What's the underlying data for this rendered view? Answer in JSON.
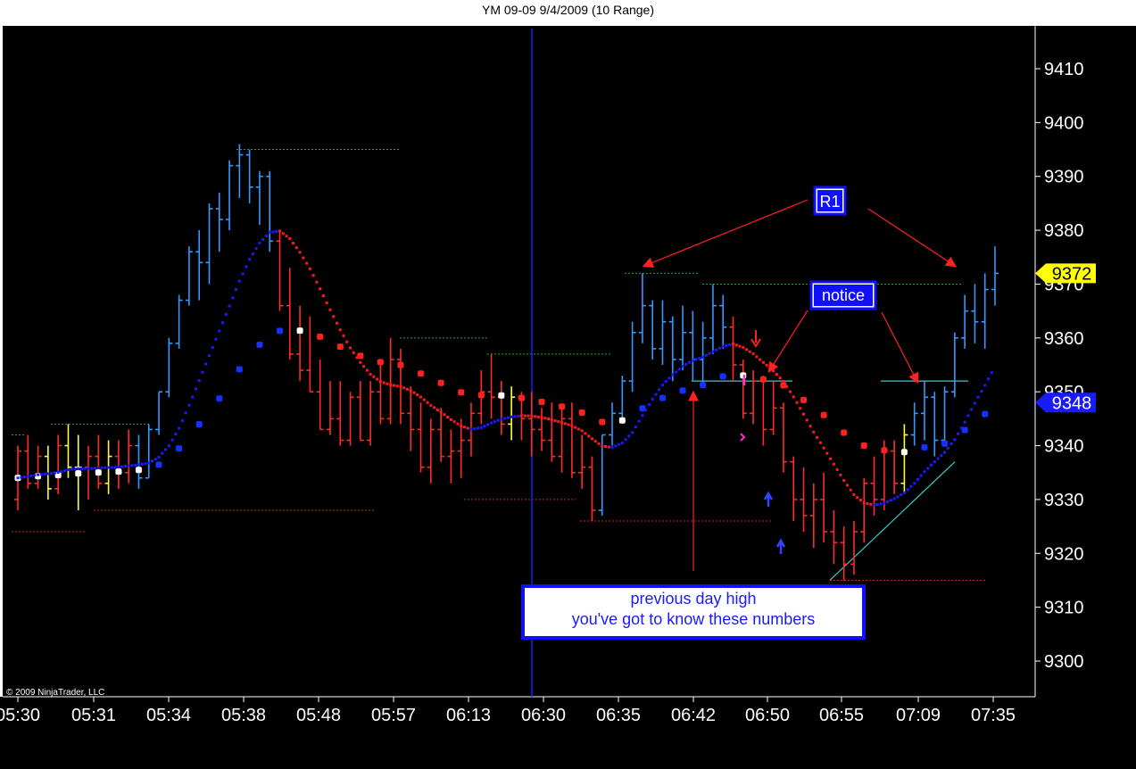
{
  "window": {
    "title": "YM 09-09  9/4/2009 (10 Range)"
  },
  "copyright": "© 2009 NinjaTrader, LLC",
  "annotations": {
    "r1": "R1",
    "notice": "notice",
    "note_line1": "previous day high",
    "note_line2": "you've got to know these numbers"
  },
  "colors": {
    "background": "#000000",
    "up_bar": "#3399ff",
    "down_bar": "#ff2a2a",
    "neutral_bar": "#ffff33",
    "slow_avg_up": "#1530ff",
    "slow_avg_down": "#ff2020",
    "slow_avg_flat": "#ffffff",
    "fast_avg_up": "#1a1aff",
    "fast_avg_down": "#ff1a1a",
    "arrows": "#ff2020",
    "level_lines": "#33cccc",
    "note_border": "#1010ff"
  },
  "chart_data": {
    "type": "ohlc",
    "symbol": "YM 09-09",
    "date": "9/4/2009",
    "bar_type": "10 Range",
    "ylim": [
      9294,
      9414
    ],
    "y_ticks": [
      9300,
      9310,
      9320,
      9330,
      9340,
      9350,
      9360,
      9370,
      9380,
      9390,
      9400,
      9410
    ],
    "x_tick_labels": [
      "05:30",
      "05:31",
      "05:34",
      "05:38",
      "05:48",
      "05:57",
      "06:13",
      "06:30",
      "06:35",
      "06:42",
      "06:50",
      "06:55",
      "07:09",
      "07:35"
    ],
    "price_markers": [
      {
        "label": "9372",
        "value": 9372,
        "color": "#ffff00"
      },
      {
        "label": "9348",
        "value": 9348,
        "color": "#1a1aff"
      }
    ],
    "bars": [
      {
        "o": 9330,
        "h": 9340,
        "l": 9328,
        "c": 9339,
        "color": "red"
      },
      {
        "o": 9339,
        "h": 9342,
        "l": 9332,
        "c": 9333,
        "color": "red"
      },
      {
        "o": 9333,
        "h": 9340,
        "l": 9332,
        "c": 9338,
        "color": "red"
      },
      {
        "o": 9338,
        "h": 9340,
        "l": 9330,
        "c": 9332,
        "color": "yellow"
      },
      {
        "o": 9332,
        "h": 9342,
        "l": 9331,
        "c": 9340,
        "color": "red"
      },
      {
        "o": 9340,
        "h": 9344,
        "l": 9334,
        "c": 9336,
        "color": "yellow"
      },
      {
        "o": 9336,
        "h": 9342,
        "l": 9328,
        "c": 9336,
        "color": "yellow"
      },
      {
        "o": 9336,
        "h": 9340,
        "l": 9330,
        "c": 9338,
        "color": "red"
      },
      {
        "o": 9338,
        "h": 9342,
        "l": 9332,
        "c": 9333,
        "color": "red"
      },
      {
        "o": 9333,
        "h": 9341,
        "l": 9331,
        "c": 9338,
        "color": "yellow"
      },
      {
        "o": 9338,
        "h": 9341,
        "l": 9332,
        "c": 9335,
        "color": "red"
      },
      {
        "o": 9335,
        "h": 9343,
        "l": 9333,
        "c": 9340,
        "color": "red"
      },
      {
        "o": 9340,
        "h": 9342,
        "l": 9332,
        "c": 9334,
        "color": "blue"
      },
      {
        "o": 9334,
        "h": 9344,
        "l": 9334,
        "c": 9343,
        "color": "blue"
      },
      {
        "o": 9343,
        "h": 9350,
        "l": 9342,
        "c": 9350,
        "color": "blue"
      },
      {
        "o": 9350,
        "h": 9360,
        "l": 9349,
        "c": 9359,
        "color": "blue"
      },
      {
        "o": 9359,
        "h": 9368,
        "l": 9358,
        "c": 9367,
        "color": "blue"
      },
      {
        "o": 9367,
        "h": 9377,
        "l": 9366,
        "c": 9376,
        "color": "blue"
      },
      {
        "o": 9376,
        "h": 9380,
        "l": 9367,
        "c": 9374,
        "color": "blue"
      },
      {
        "o": 9374,
        "h": 9385,
        "l": 9370,
        "c": 9384,
        "color": "blue"
      },
      {
        "o": 9384,
        "h": 9387,
        "l": 9376,
        "c": 9382,
        "color": "blue"
      },
      {
        "o": 9382,
        "h": 9393,
        "l": 9380,
        "c": 9392,
        "color": "blue"
      },
      {
        "o": 9392,
        "h": 9396,
        "l": 9386,
        "c": 9394,
        "color": "blue"
      },
      {
        "o": 9394,
        "h": 9395,
        "l": 9385,
        "c": 9388,
        "color": "blue"
      },
      {
        "o": 9388,
        "h": 9391,
        "l": 9381,
        "c": 9390,
        "color": "blue"
      },
      {
        "o": 9390,
        "h": 9391,
        "l": 9376,
        "c": 9378,
        "color": "blue"
      },
      {
        "o": 9378,
        "h": 9380,
        "l": 9365,
        "c": 9366,
        "color": "red"
      },
      {
        "o": 9366,
        "h": 9373,
        "l": 9356,
        "c": 9357,
        "color": "red"
      },
      {
        "o": 9357,
        "h": 9366,
        "l": 9352,
        "c": 9354,
        "color": "red"
      },
      {
        "o": 9354,
        "h": 9364,
        "l": 9350,
        "c": 9350,
        "color": "red"
      },
      {
        "o": 9350,
        "h": 9356,
        "l": 9343,
        "c": 9343,
        "color": "red"
      },
      {
        "o": 9343,
        "h": 9352,
        "l": 9342,
        "c": 9345,
        "color": "red"
      },
      {
        "o": 9345,
        "h": 9352,
        "l": 9340,
        "c": 9341,
        "color": "red"
      },
      {
        "o": 9341,
        "h": 9350,
        "l": 9340,
        "c": 9349,
        "color": "red"
      },
      {
        "o": 9349,
        "h": 9352,
        "l": 9341,
        "c": 9341,
        "color": "red"
      },
      {
        "o": 9341,
        "h": 9352,
        "l": 9340,
        "c": 9350,
        "color": "red"
      },
      {
        "o": 9350,
        "h": 9356,
        "l": 9344,
        "c": 9345,
        "color": "red"
      },
      {
        "o": 9345,
        "h": 9360,
        "l": 9344,
        "c": 9356,
        "color": "red"
      },
      {
        "o": 9356,
        "h": 9358,
        "l": 9344,
        "c": 9346,
        "color": "red"
      },
      {
        "o": 9346,
        "h": 9351,
        "l": 9339,
        "c": 9343,
        "color": "red"
      },
      {
        "o": 9343,
        "h": 9348,
        "l": 9335,
        "c": 9336,
        "color": "red"
      },
      {
        "o": 9336,
        "h": 9345,
        "l": 9333,
        "c": 9343,
        "color": "red"
      },
      {
        "o": 9343,
        "h": 9347,
        "l": 9337,
        "c": 9338,
        "color": "red"
      },
      {
        "o": 9338,
        "h": 9343,
        "l": 9333,
        "c": 9339,
        "color": "red"
      },
      {
        "o": 9339,
        "h": 9345,
        "l": 9334,
        "c": 9341,
        "color": "red"
      },
      {
        "o": 9341,
        "h": 9348,
        "l": 9338,
        "c": 9346,
        "color": "red"
      },
      {
        "o": 9346,
        "h": 9354,
        "l": 9344,
        "c": 9350,
        "color": "red"
      },
      {
        "o": 9350,
        "h": 9357,
        "l": 9345,
        "c": 9349,
        "color": "red"
      },
      {
        "o": 9349,
        "h": 9352,
        "l": 9342,
        "c": 9344,
        "color": "red"
      },
      {
        "o": 9344,
        "h": 9351,
        "l": 9341,
        "c": 9349,
        "color": "yellow"
      },
      {
        "o": 9349,
        "h": 9350,
        "l": 9341,
        "c": 9345,
        "color": "red"
      },
      {
        "o": 9345,
        "h": 9350,
        "l": 9338,
        "c": 9343,
        "color": "red"
      },
      {
        "o": 9343,
        "h": 9347,
        "l": 9339,
        "c": 9341,
        "color": "red"
      },
      {
        "o": 9341,
        "h": 9348,
        "l": 9337,
        "c": 9338,
        "color": "red"
      },
      {
        "o": 9338,
        "h": 9347,
        "l": 9335,
        "c": 9345,
        "color": "red"
      },
      {
        "o": 9345,
        "h": 9348,
        "l": 9334,
        "c": 9335,
        "color": "red"
      },
      {
        "o": 9335,
        "h": 9342,
        "l": 9332,
        "c": 9336,
        "color": "red"
      },
      {
        "o": 9336,
        "h": 9338,
        "l": 9326,
        "c": 9328,
        "color": "red"
      },
      {
        "o": 9328,
        "h": 9342,
        "l": 9327,
        "c": 9342,
        "color": "blue"
      },
      {
        "o": 9342,
        "h": 9348,
        "l": 9340,
        "c": 9346,
        "color": "blue"
      },
      {
        "o": 9346,
        "h": 9353,
        "l": 9345,
        "c": 9352,
        "color": "blue"
      },
      {
        "o": 9352,
        "h": 9363,
        "l": 9350,
        "c": 9361,
        "color": "blue"
      },
      {
        "o": 9361,
        "h": 9372,
        "l": 9359,
        "c": 9366,
        "color": "blue"
      },
      {
        "o": 9366,
        "h": 9367,
        "l": 9356,
        "c": 9358,
        "color": "blue"
      },
      {
        "o": 9358,
        "h": 9367,
        "l": 9355,
        "c": 9363,
        "color": "blue"
      },
      {
        "o": 9363,
        "h": 9364,
        "l": 9352,
        "c": 9356,
        "color": "blue"
      },
      {
        "o": 9356,
        "h": 9366,
        "l": 9354,
        "c": 9361,
        "color": "blue"
      },
      {
        "o": 9361,
        "h": 9365,
        "l": 9352,
        "c": 9356,
        "color": "blue"
      },
      {
        "o": 9356,
        "h": 9363,
        "l": 9351,
        "c": 9360,
        "color": "blue"
      },
      {
        "o": 9360,
        "h": 9370,
        "l": 9357,
        "c": 9366,
        "color": "blue"
      },
      {
        "o": 9366,
        "h": 9368,
        "l": 9358,
        "c": 9362,
        "color": "blue"
      },
      {
        "o": 9362,
        "h": 9364,
        "l": 9352,
        "c": 9355,
        "color": "red"
      },
      {
        "o": 9355,
        "h": 9356,
        "l": 9345,
        "c": 9346,
        "color": "red"
      },
      {
        "o": 9346,
        "h": 9354,
        "l": 9344,
        "c": 9352,
        "color": "red"
      },
      {
        "o": 9352,
        "h": 9353,
        "l": 9340,
        "c": 9343,
        "color": "red"
      },
      {
        "o": 9343,
        "h": 9352,
        "l": 9342,
        "c": 9347,
        "color": "red"
      },
      {
        "o": 9347,
        "h": 9348,
        "l": 9335,
        "c": 9337,
        "color": "red"
      },
      {
        "o": 9337,
        "h": 9338,
        "l": 9326,
        "c": 9330,
        "color": "red"
      },
      {
        "o": 9330,
        "h": 9336,
        "l": 9324,
        "c": 9327,
        "color": "red"
      },
      {
        "o": 9327,
        "h": 9333,
        "l": 9321,
        "c": 9330,
        "color": "red"
      },
      {
        "o": 9330,
        "h": 9335,
        "l": 9322,
        "c": 9324,
        "color": "red"
      },
      {
        "o": 9324,
        "h": 9328,
        "l": 9318,
        "c": 9322,
        "color": "red"
      },
      {
        "o": 9322,
        "h": 9325,
        "l": 9315,
        "c": 9318,
        "color": "red"
      },
      {
        "o": 9318,
        "h": 9326,
        "l": 9316,
        "c": 9324,
        "color": "red"
      },
      {
        "o": 9324,
        "h": 9334,
        "l": 9322,
        "c": 9333,
        "color": "red"
      },
      {
        "o": 9333,
        "h": 9338,
        "l": 9327,
        "c": 9330,
        "color": "red"
      },
      {
        "o": 9330,
        "h": 9341,
        "l": 9328,
        "c": 9339,
        "color": "red"
      },
      {
        "o": 9339,
        "h": 9341,
        "l": 9331,
        "c": 9333,
        "color": "red"
      },
      {
        "o": 9333,
        "h": 9344,
        "l": 9331,
        "c": 9342,
        "color": "yellow"
      },
      {
        "o": 9342,
        "h": 9348,
        "l": 9340,
        "c": 9346,
        "color": "blue"
      },
      {
        "o": 9346,
        "h": 9352,
        "l": 9341,
        "c": 9349,
        "color": "blue"
      },
      {
        "o": 9349,
        "h": 9350,
        "l": 9338,
        "c": 9341,
        "color": "blue"
      },
      {
        "o": 9341,
        "h": 9351,
        "l": 9340,
        "c": 9350,
        "color": "blue"
      },
      {
        "o": 9350,
        "h": 9361,
        "l": 9349,
        "c": 9360,
        "color": "blue"
      },
      {
        "o": 9360,
        "h": 9368,
        "l": 9358,
        "c": 9365,
        "color": "blue"
      },
      {
        "o": 9365,
        "h": 9370,
        "l": 9359,
        "c": 9363,
        "color": "blue"
      },
      {
        "o": 9363,
        "h": 9372,
        "l": 9358,
        "c": 9369,
        "color": "blue"
      },
      {
        "o": 9369,
        "h": 9377,
        "l": 9366,
        "c": 9372,
        "color": "blue"
      }
    ],
    "dotted_levels": [
      {
        "value": 9395,
        "color": "green"
      },
      {
        "value": 9372,
        "color": "green"
      },
      {
        "value": 9370,
        "color": "green"
      },
      {
        "value": 9360,
        "color": "green"
      },
      {
        "value": 9357,
        "color": "green"
      },
      {
        "value": 9344,
        "color": "green"
      },
      {
        "value": 9342,
        "color": "green"
      },
      {
        "value": 9330,
        "color": "red"
      },
      {
        "value": 9328,
        "color": "red"
      },
      {
        "value": 9326,
        "color": "red"
      },
      {
        "value": 9324,
        "color": "red"
      },
      {
        "value": 9315,
        "color": "red"
      }
    ],
    "cyan_lines": [
      {
        "value": 9352
      },
      {
        "value": 9352
      }
    ]
  }
}
